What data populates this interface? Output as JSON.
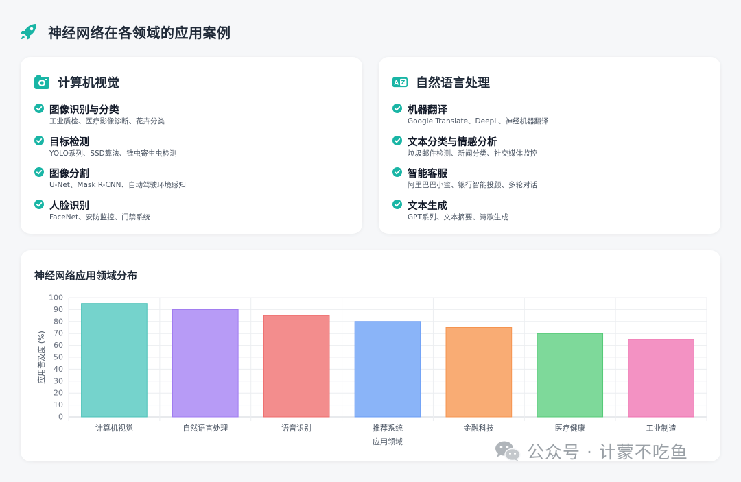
{
  "page": {
    "title": "神经网络在各领域的应用案例",
    "header_icon": "rocket-icon",
    "accent_color": "#19b5a5"
  },
  "cards": {
    "cv": {
      "title": "计算机视觉",
      "icon": "camera-icon",
      "items": [
        {
          "title": "图像识别与分类",
          "desc": "工业质检、医疗影像诊断、花卉分类"
        },
        {
          "title": "目标检测",
          "desc": "YOLO系列、SSD算法、锥虫寄生虫检测"
        },
        {
          "title": "图像分割",
          "desc": "U-Net、Mask R-CNN、自动驾驶环境感知"
        },
        {
          "title": "人脸识别",
          "desc": "FaceNet、安防监控、门禁系统"
        }
      ]
    },
    "nlp": {
      "title": "自然语言处理",
      "icon": "language-icon",
      "items": [
        {
          "title": "机器翻译",
          "desc": "Google Translate、DeepL、神经机器翻译"
        },
        {
          "title": "文本分类与情感分析",
          "desc": "垃圾邮件检测、新闻分类、社交媒体监控"
        },
        {
          "title": "智能客服",
          "desc": "阿里巴巴小蜜、银行智能投顾、多轮对话"
        },
        {
          "title": "文本生成",
          "desc": "GPT系列、文本摘要、诗歌生成"
        }
      ]
    }
  },
  "chart_data": {
    "type": "bar",
    "title": "神经网络应用领域分布",
    "xlabel": "应用领域",
    "ylabel": "应用普及度 (%)",
    "ylim": [
      0,
      100
    ],
    "yticks": [
      0,
      10,
      20,
      30,
      40,
      50,
      60,
      70,
      80,
      90,
      100
    ],
    "grid": true,
    "categories": [
      "计算机视觉",
      "自然语言处理",
      "语音识别",
      "推荐系统",
      "金融科技",
      "医疗健康",
      "工业制造"
    ],
    "values": [
      95,
      90,
      85,
      80,
      75,
      70,
      65
    ],
    "colors": [
      {
        "fill": "#75d3cc",
        "stroke": "#4cc2b8"
      },
      {
        "fill": "#b79bf6",
        "stroke": "#9f7bf0"
      },
      {
        "fill": "#f38d8d",
        "stroke": "#ee6b6b"
      },
      {
        "fill": "#8ab4f8",
        "stroke": "#6a9cf5"
      },
      {
        "fill": "#f9ac74",
        "stroke": "#f59450"
      },
      {
        "fill": "#7ed99a",
        "stroke": "#55c977"
      },
      {
        "fill": "#f392c3",
        "stroke": "#ee73b0"
      }
    ]
  },
  "watermark": {
    "text": "公众号 · 计蒙不吃鱼",
    "icon": "wechat-icon"
  }
}
